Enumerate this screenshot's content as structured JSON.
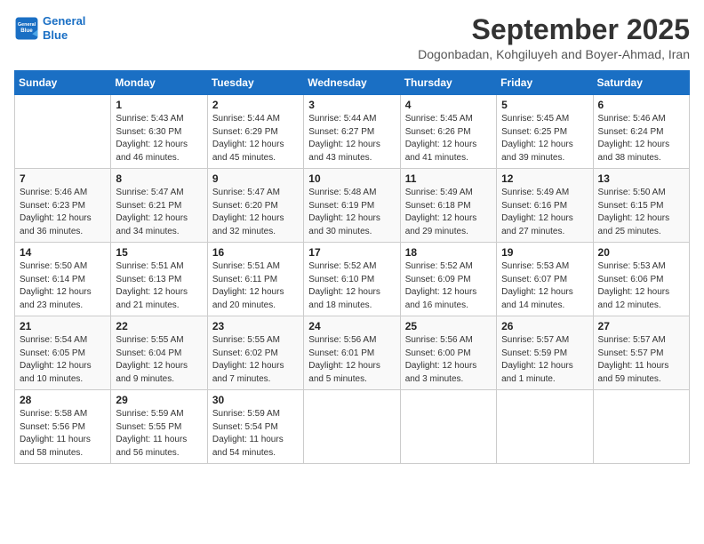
{
  "header": {
    "logo_line1": "General",
    "logo_line2": "Blue",
    "month_title": "September 2025",
    "subtitle": "Dogonbadan, Kohgiluyeh and Boyer-Ahmad, Iran"
  },
  "days_of_week": [
    "Sunday",
    "Monday",
    "Tuesday",
    "Wednesday",
    "Thursday",
    "Friday",
    "Saturday"
  ],
  "weeks": [
    [
      {
        "day": "",
        "info": ""
      },
      {
        "day": "1",
        "info": "Sunrise: 5:43 AM\nSunset: 6:30 PM\nDaylight: 12 hours\nand 46 minutes."
      },
      {
        "day": "2",
        "info": "Sunrise: 5:44 AM\nSunset: 6:29 PM\nDaylight: 12 hours\nand 45 minutes."
      },
      {
        "day": "3",
        "info": "Sunrise: 5:44 AM\nSunset: 6:27 PM\nDaylight: 12 hours\nand 43 minutes."
      },
      {
        "day": "4",
        "info": "Sunrise: 5:45 AM\nSunset: 6:26 PM\nDaylight: 12 hours\nand 41 minutes."
      },
      {
        "day": "5",
        "info": "Sunrise: 5:45 AM\nSunset: 6:25 PM\nDaylight: 12 hours\nand 39 minutes."
      },
      {
        "day": "6",
        "info": "Sunrise: 5:46 AM\nSunset: 6:24 PM\nDaylight: 12 hours\nand 38 minutes."
      }
    ],
    [
      {
        "day": "7",
        "info": "Sunrise: 5:46 AM\nSunset: 6:23 PM\nDaylight: 12 hours\nand 36 minutes."
      },
      {
        "day": "8",
        "info": "Sunrise: 5:47 AM\nSunset: 6:21 PM\nDaylight: 12 hours\nand 34 minutes."
      },
      {
        "day": "9",
        "info": "Sunrise: 5:47 AM\nSunset: 6:20 PM\nDaylight: 12 hours\nand 32 minutes."
      },
      {
        "day": "10",
        "info": "Sunrise: 5:48 AM\nSunset: 6:19 PM\nDaylight: 12 hours\nand 30 minutes."
      },
      {
        "day": "11",
        "info": "Sunrise: 5:49 AM\nSunset: 6:18 PM\nDaylight: 12 hours\nand 29 minutes."
      },
      {
        "day": "12",
        "info": "Sunrise: 5:49 AM\nSunset: 6:16 PM\nDaylight: 12 hours\nand 27 minutes."
      },
      {
        "day": "13",
        "info": "Sunrise: 5:50 AM\nSunset: 6:15 PM\nDaylight: 12 hours\nand 25 minutes."
      }
    ],
    [
      {
        "day": "14",
        "info": "Sunrise: 5:50 AM\nSunset: 6:14 PM\nDaylight: 12 hours\nand 23 minutes."
      },
      {
        "day": "15",
        "info": "Sunrise: 5:51 AM\nSunset: 6:13 PM\nDaylight: 12 hours\nand 21 minutes."
      },
      {
        "day": "16",
        "info": "Sunrise: 5:51 AM\nSunset: 6:11 PM\nDaylight: 12 hours\nand 20 minutes."
      },
      {
        "day": "17",
        "info": "Sunrise: 5:52 AM\nSunset: 6:10 PM\nDaylight: 12 hours\nand 18 minutes."
      },
      {
        "day": "18",
        "info": "Sunrise: 5:52 AM\nSunset: 6:09 PM\nDaylight: 12 hours\nand 16 minutes."
      },
      {
        "day": "19",
        "info": "Sunrise: 5:53 AM\nSunset: 6:07 PM\nDaylight: 12 hours\nand 14 minutes."
      },
      {
        "day": "20",
        "info": "Sunrise: 5:53 AM\nSunset: 6:06 PM\nDaylight: 12 hours\nand 12 minutes."
      }
    ],
    [
      {
        "day": "21",
        "info": "Sunrise: 5:54 AM\nSunset: 6:05 PM\nDaylight: 12 hours\nand 10 minutes."
      },
      {
        "day": "22",
        "info": "Sunrise: 5:55 AM\nSunset: 6:04 PM\nDaylight: 12 hours\nand 9 minutes."
      },
      {
        "day": "23",
        "info": "Sunrise: 5:55 AM\nSunset: 6:02 PM\nDaylight: 12 hours\nand 7 minutes."
      },
      {
        "day": "24",
        "info": "Sunrise: 5:56 AM\nSunset: 6:01 PM\nDaylight: 12 hours\nand 5 minutes."
      },
      {
        "day": "25",
        "info": "Sunrise: 5:56 AM\nSunset: 6:00 PM\nDaylight: 12 hours\nand 3 minutes."
      },
      {
        "day": "26",
        "info": "Sunrise: 5:57 AM\nSunset: 5:59 PM\nDaylight: 12 hours\nand 1 minute."
      },
      {
        "day": "27",
        "info": "Sunrise: 5:57 AM\nSunset: 5:57 PM\nDaylight: 11 hours\nand 59 minutes."
      }
    ],
    [
      {
        "day": "28",
        "info": "Sunrise: 5:58 AM\nSunset: 5:56 PM\nDaylight: 11 hours\nand 58 minutes."
      },
      {
        "day": "29",
        "info": "Sunrise: 5:59 AM\nSunset: 5:55 PM\nDaylight: 11 hours\nand 56 minutes."
      },
      {
        "day": "30",
        "info": "Sunrise: 5:59 AM\nSunset: 5:54 PM\nDaylight: 11 hours\nand 54 minutes."
      },
      {
        "day": "",
        "info": ""
      },
      {
        "day": "",
        "info": ""
      },
      {
        "day": "",
        "info": ""
      },
      {
        "day": "",
        "info": ""
      }
    ]
  ]
}
